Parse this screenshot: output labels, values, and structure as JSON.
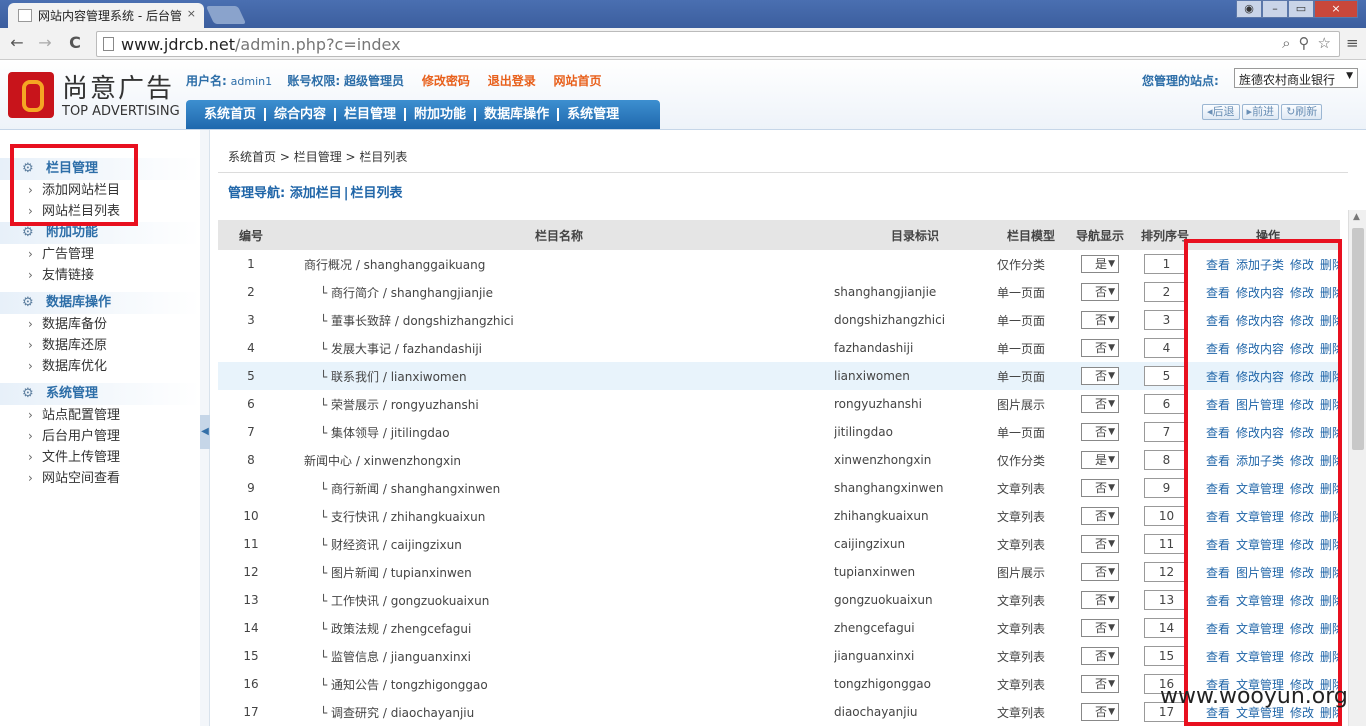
{
  "browser": {
    "tab_title": "网站内容管理系统 - 后台管",
    "tab_close": "×",
    "url_domain": "www.jdrcb.net",
    "url_path": "/admin.php?c=index",
    "back": "←",
    "forward": "→",
    "reload": "C",
    "win_min": "–",
    "win_max": "▭",
    "win_close": "×"
  },
  "header": {
    "logo_cn": "尚意广告",
    "logo_en": "TOP ADVERTISING",
    "username_label": "用户名:",
    "username": "admin1",
    "rights_label": "账号权限:",
    "rights": "超级管理员",
    "change_password": "修改密码",
    "logout": "退出登录",
    "site_home": "网站首页",
    "site_label": "您管理的站点:",
    "site_value": "旌德农村商业银行",
    "menu": [
      "系统首页",
      "综合内容",
      "栏目管理",
      "附加功能",
      "数据库操作",
      "系统管理"
    ],
    "hist": [
      "后退",
      "前进",
      "刷新"
    ]
  },
  "sidebar": [
    {
      "title": "栏目管理",
      "items": [
        "添加网站栏目",
        "网站栏目列表"
      ]
    },
    {
      "title": "附加功能",
      "items": [
        "广告管理",
        "友情链接"
      ]
    },
    {
      "title": "数据库操作",
      "items": [
        "数据库备份",
        "数据库还原",
        "数据库优化"
      ]
    },
    {
      "title": "系统管理",
      "items": [
        "站点配置管理",
        "后台用户管理",
        "文件上传管理",
        "网站空间查看"
      ]
    }
  ],
  "breadcrumb": {
    "a": "系统首页",
    "b": "栏目管理",
    "c": "栏目列表",
    "sep": " > "
  },
  "mgmt_nav": {
    "label": "管理导航:",
    "add": "添加栏目",
    "sep": "|",
    "list": "栏目列表"
  },
  "table": {
    "headers": [
      "编号",
      "栏目名称",
      "目录标识",
      "栏目模型",
      "导航显示",
      "排列序号",
      "操作"
    ],
    "rows": [
      {
        "id": "1",
        "name": "商行概况 / shanghanggaikuang",
        "child": false,
        "dir": "",
        "model": "仅作分类",
        "nav": "是",
        "order": "1",
        "op2": "添加子类"
      },
      {
        "id": "2",
        "name": "└ 商行简介 / shanghangjianjie",
        "child": true,
        "dir": "shanghangjianjie",
        "model": "单一页面",
        "nav": "否",
        "order": "2",
        "op2": "修改内容"
      },
      {
        "id": "3",
        "name": "└ 董事长致辞 / dongshizhangzhici",
        "child": true,
        "dir": "dongshizhangzhici",
        "model": "单一页面",
        "nav": "否",
        "order": "3",
        "op2": "修改内容"
      },
      {
        "id": "4",
        "name": "└ 发展大事记 / fazhandashiji",
        "child": true,
        "dir": "fazhandashiji",
        "model": "单一页面",
        "nav": "否",
        "order": "4",
        "op2": "修改内容"
      },
      {
        "id": "5",
        "name": "└ 联系我们 / lianxiwomen",
        "child": true,
        "dir": "lianxiwomen",
        "model": "单一页面",
        "nav": "否",
        "order": "5",
        "op2": "修改内容"
      },
      {
        "id": "6",
        "name": "└ 荣誉展示 / rongyuzhanshi",
        "child": true,
        "dir": "rongyuzhanshi",
        "model": "图片展示",
        "nav": "否",
        "order": "6",
        "op2": "图片管理"
      },
      {
        "id": "7",
        "name": "└ 集体领导 / jitilingdao",
        "child": true,
        "dir": "jitilingdao",
        "model": "单一页面",
        "nav": "否",
        "order": "7",
        "op2": "修改内容"
      },
      {
        "id": "8",
        "name": "新闻中心 / xinwenzhongxin",
        "child": false,
        "dir": "xinwenzhongxin",
        "model": "仅作分类",
        "nav": "是",
        "order": "8",
        "op2": "添加子类"
      },
      {
        "id": "9",
        "name": "└ 商行新闻 / shanghangxinwen",
        "child": true,
        "dir": "shanghangxinwen",
        "model": "文章列表",
        "nav": "否",
        "order": "9",
        "op2": "文章管理"
      },
      {
        "id": "10",
        "name": "└ 支行快讯 / zhihangkuaixun",
        "child": true,
        "dir": "zhihangkuaixun",
        "model": "文章列表",
        "nav": "否",
        "order": "10",
        "op2": "文章管理"
      },
      {
        "id": "11",
        "name": "└ 财经资讯 / caijingzixun",
        "child": true,
        "dir": "caijingzixun",
        "model": "文章列表",
        "nav": "否",
        "order": "11",
        "op2": "文章管理"
      },
      {
        "id": "12",
        "name": "└ 图片新闻 / tupianxinwen",
        "child": true,
        "dir": "tupianxinwen",
        "model": "图片展示",
        "nav": "否",
        "order": "12",
        "op2": "图片管理"
      },
      {
        "id": "13",
        "name": "└ 工作快讯 / gongzuokuaixun",
        "child": true,
        "dir": "gongzuokuaixun",
        "model": "文章列表",
        "nav": "否",
        "order": "13",
        "op2": "文章管理"
      },
      {
        "id": "14",
        "name": "└ 政策法规 / zhengcefagui",
        "child": true,
        "dir": "zhengcefagui",
        "model": "文章列表",
        "nav": "否",
        "order": "14",
        "op2": "文章管理"
      },
      {
        "id": "15",
        "name": "└ 监管信息 / jianguanxinxi",
        "child": true,
        "dir": "jianguanxinxi",
        "model": "文章列表",
        "nav": "否",
        "order": "15",
        "op2": "文章管理"
      },
      {
        "id": "16",
        "name": "└ 通知公告 / tongzhigonggao",
        "child": true,
        "dir": "tongzhigonggao",
        "model": "文章列表",
        "nav": "否",
        "order": "16",
        "op2": "文章管理"
      },
      {
        "id": "17",
        "name": "└ 调查研究 / diaochayanjiu",
        "child": true,
        "dir": "diaochayanjiu",
        "model": "文章列表",
        "nav": "否",
        "order": "17",
        "op2": "文章管理"
      }
    ],
    "op_view": "查看",
    "op_edit": "修改",
    "op_delete": "删除"
  },
  "watermark": "www.wooyun.org"
}
